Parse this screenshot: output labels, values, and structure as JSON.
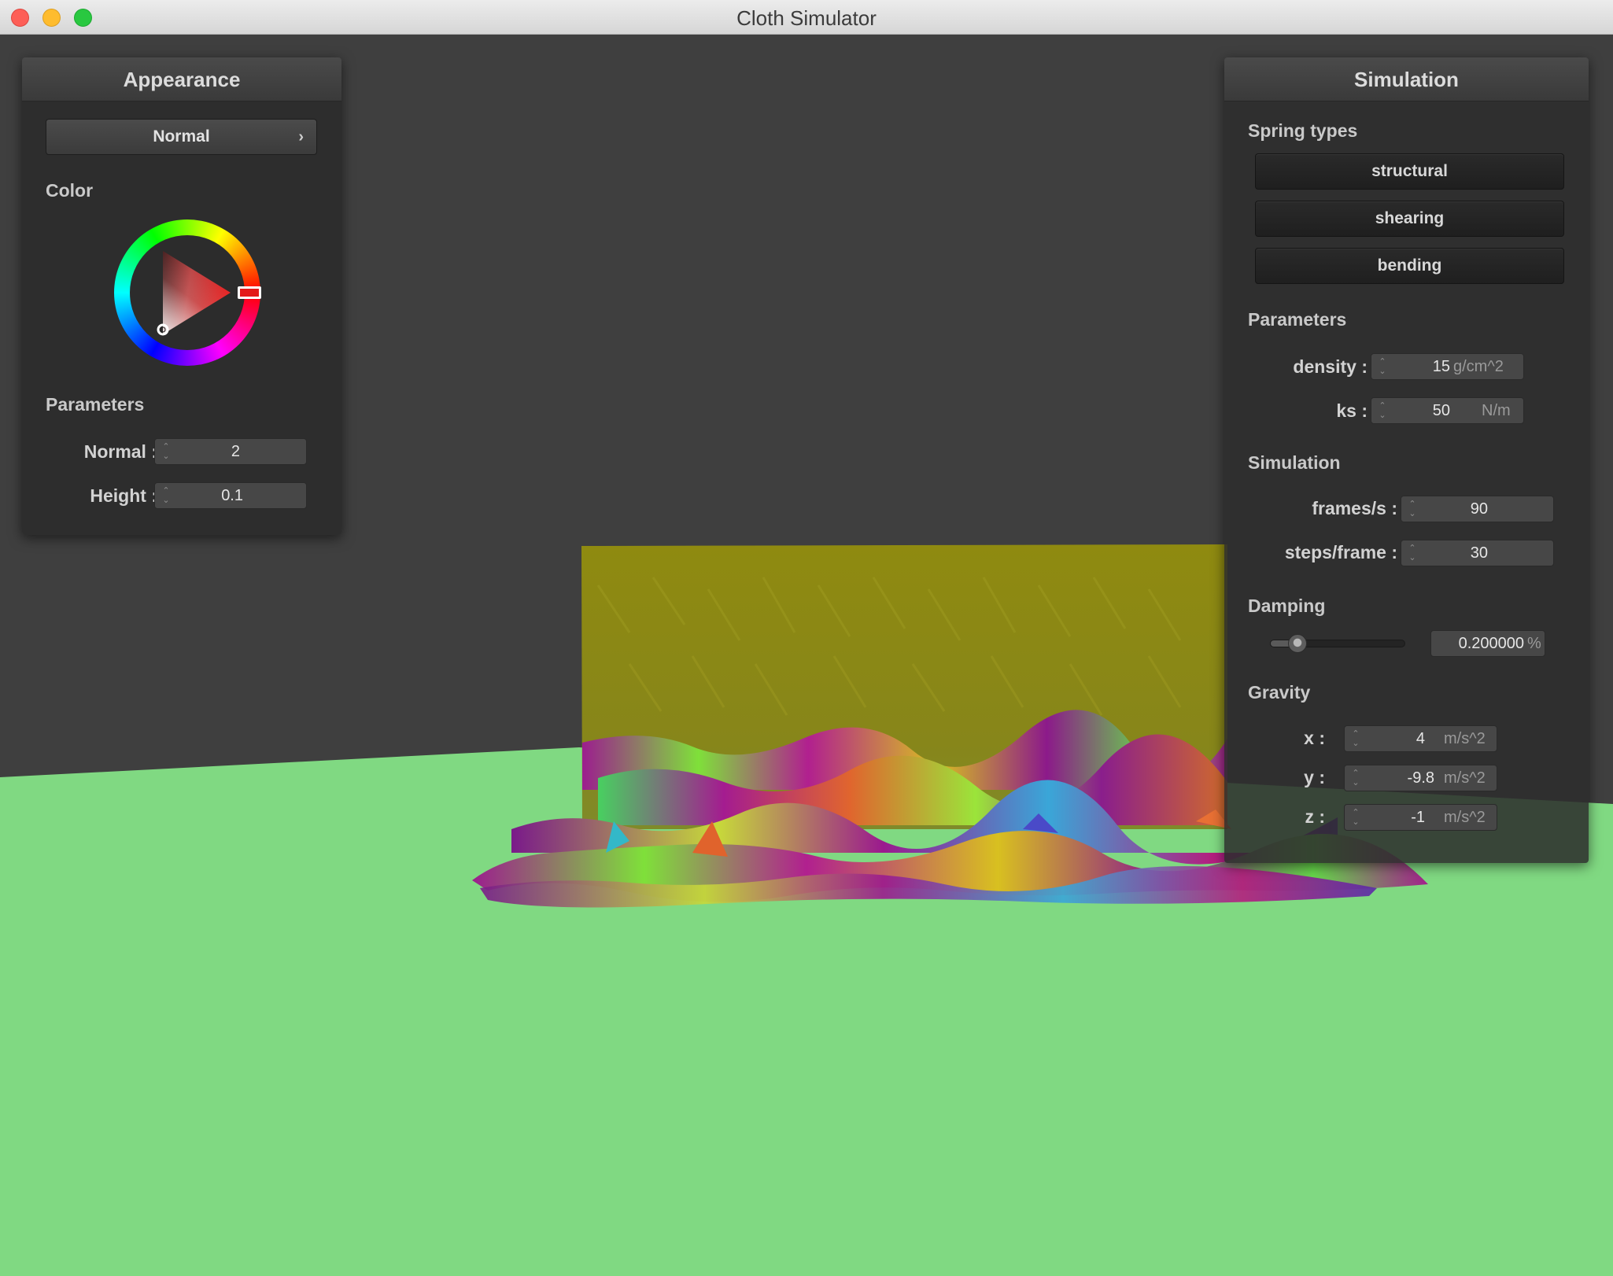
{
  "window": {
    "title": "Cloth Simulator"
  },
  "appearance": {
    "header": "Appearance",
    "shader": "Normal",
    "color_label": "Color",
    "selected_color": "#e31a1a",
    "params_label": "Parameters",
    "normal_label": "Normal :",
    "normal_value": "2",
    "height_label": "Height :",
    "height_value": "0.1"
  },
  "simulation": {
    "header": "Simulation",
    "spring_types_label": "Spring types",
    "spring_types": [
      "structural",
      "shearing",
      "bending"
    ],
    "params_label": "Parameters",
    "density_label": "density :",
    "density_value": "15",
    "density_unit": "g/cm^2",
    "ks_label": "ks :",
    "ks_value": "50",
    "ks_unit": "N/m",
    "sim_label": "Simulation",
    "fps_label": "frames/s :",
    "fps_value": "90",
    "steps_label": "steps/frame :",
    "steps_value": "30",
    "damping_label": "Damping",
    "damping_value": "0.200000",
    "damping_unit": "%",
    "damping_level": 0.2,
    "gravity_label": "Gravity",
    "gx_label": "x :",
    "gx_value": "4",
    "gy_label": "y :",
    "gy_value": "-9.8",
    "gz_label": "z :",
    "gz_value": "-1",
    "gravity_unit": "m/s^2"
  },
  "scene": {
    "background_color": "#3f3f3f",
    "ground_color": "#80d982",
    "cloth_color": "#8e8a10"
  }
}
